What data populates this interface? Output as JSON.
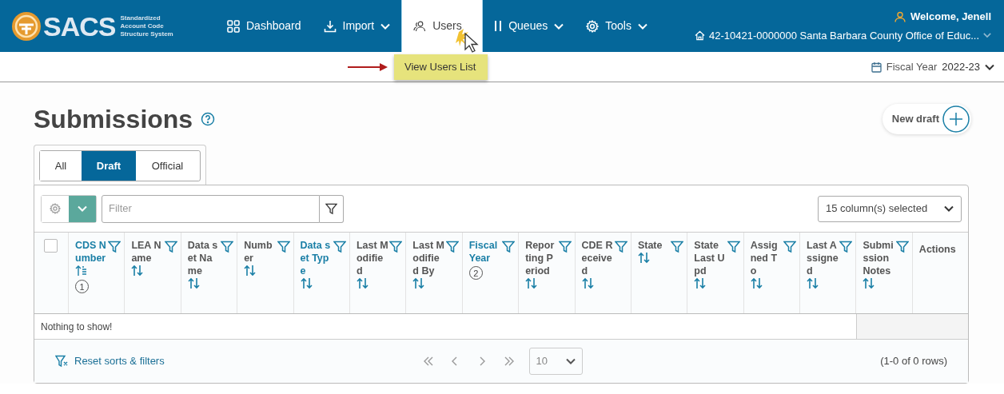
{
  "header": {
    "logo": {
      "name": "SACS",
      "tagline": [
        "Standardized",
        "Account Code",
        "Structure System"
      ]
    },
    "nav": [
      {
        "label": "Dashboard",
        "kind": "dashboard",
        "caret": false,
        "selected": false
      },
      {
        "label": "Import",
        "kind": "import",
        "caret": true,
        "selected": false
      },
      {
        "label": "Users",
        "kind": "users",
        "caret": false,
        "selected": true
      },
      {
        "label": "Queues",
        "kind": "queues",
        "caret": true,
        "selected": false
      },
      {
        "label": "Tools",
        "kind": "tools",
        "caret": true,
        "selected": false
      }
    ],
    "welcome": "Welcome, Jenell",
    "organization": "42-10421-0000000 Santa Barbara County Office of Educ..."
  },
  "dropdown": {
    "items": [
      "View Users List"
    ]
  },
  "fiscal_year": {
    "label": "Fiscal Year",
    "value": "2022-23"
  },
  "page": {
    "title": "Submissions",
    "new_draft": "New draft"
  },
  "tabs": [
    {
      "label": "All",
      "selected": false
    },
    {
      "label": "Draft",
      "selected": true
    },
    {
      "label": "Official",
      "selected": false
    }
  ],
  "toolbar": {
    "filter_placeholder": "Filter",
    "columns_selected": "15 column(s) selected"
  },
  "table": {
    "select_all_checked": false,
    "columns": [
      {
        "label": "CDS Number",
        "highlighted": true,
        "sort_icon": true,
        "sorted": true,
        "order": "1"
      },
      {
        "label": "LEA Name",
        "highlighted": false,
        "sort_icon": true,
        "sorted": false
      },
      {
        "label": "Data set Name",
        "highlighted": false,
        "sort_icon": true,
        "sorted": false
      },
      {
        "label": "Number",
        "highlighted": false,
        "sort_icon": true,
        "sorted": false
      },
      {
        "label": "Data set Type",
        "highlighted": true,
        "sort_icon": true,
        "sorted": false
      },
      {
        "label": "Last Modified",
        "highlighted": false,
        "sort_icon": true,
        "sorted": false
      },
      {
        "label": "Last Modified By",
        "highlighted": false,
        "sort_icon": true,
        "sorted": false
      },
      {
        "label": "Fiscal Year",
        "highlighted": true,
        "sort_icon": false,
        "order": "2"
      },
      {
        "label": "Reporting Period",
        "highlighted": false,
        "sort_icon": true,
        "sorted": false
      },
      {
        "label": "CDE Received",
        "highlighted": false,
        "sort_icon": true,
        "sorted": false
      },
      {
        "label": "State",
        "highlighted": false,
        "sort_icon": true,
        "sorted": false
      },
      {
        "label": "State Last Upd",
        "highlighted": false,
        "sort_icon": true,
        "sorted": false
      },
      {
        "label": "Assigned To",
        "highlighted": false,
        "sort_icon": true,
        "sorted": false
      },
      {
        "label": "Last Assigned",
        "highlighted": false,
        "sort_icon": true,
        "sorted": false
      },
      {
        "label": "Submission Notes",
        "highlighted": false,
        "sort_icon": true,
        "sorted": false
      }
    ],
    "actions_column": "Actions",
    "empty_message": "Nothing to show!"
  },
  "footer": {
    "reset": "Reset sorts & filters",
    "page_size": "10",
    "range": "(1-0 of 0 rows)"
  }
}
